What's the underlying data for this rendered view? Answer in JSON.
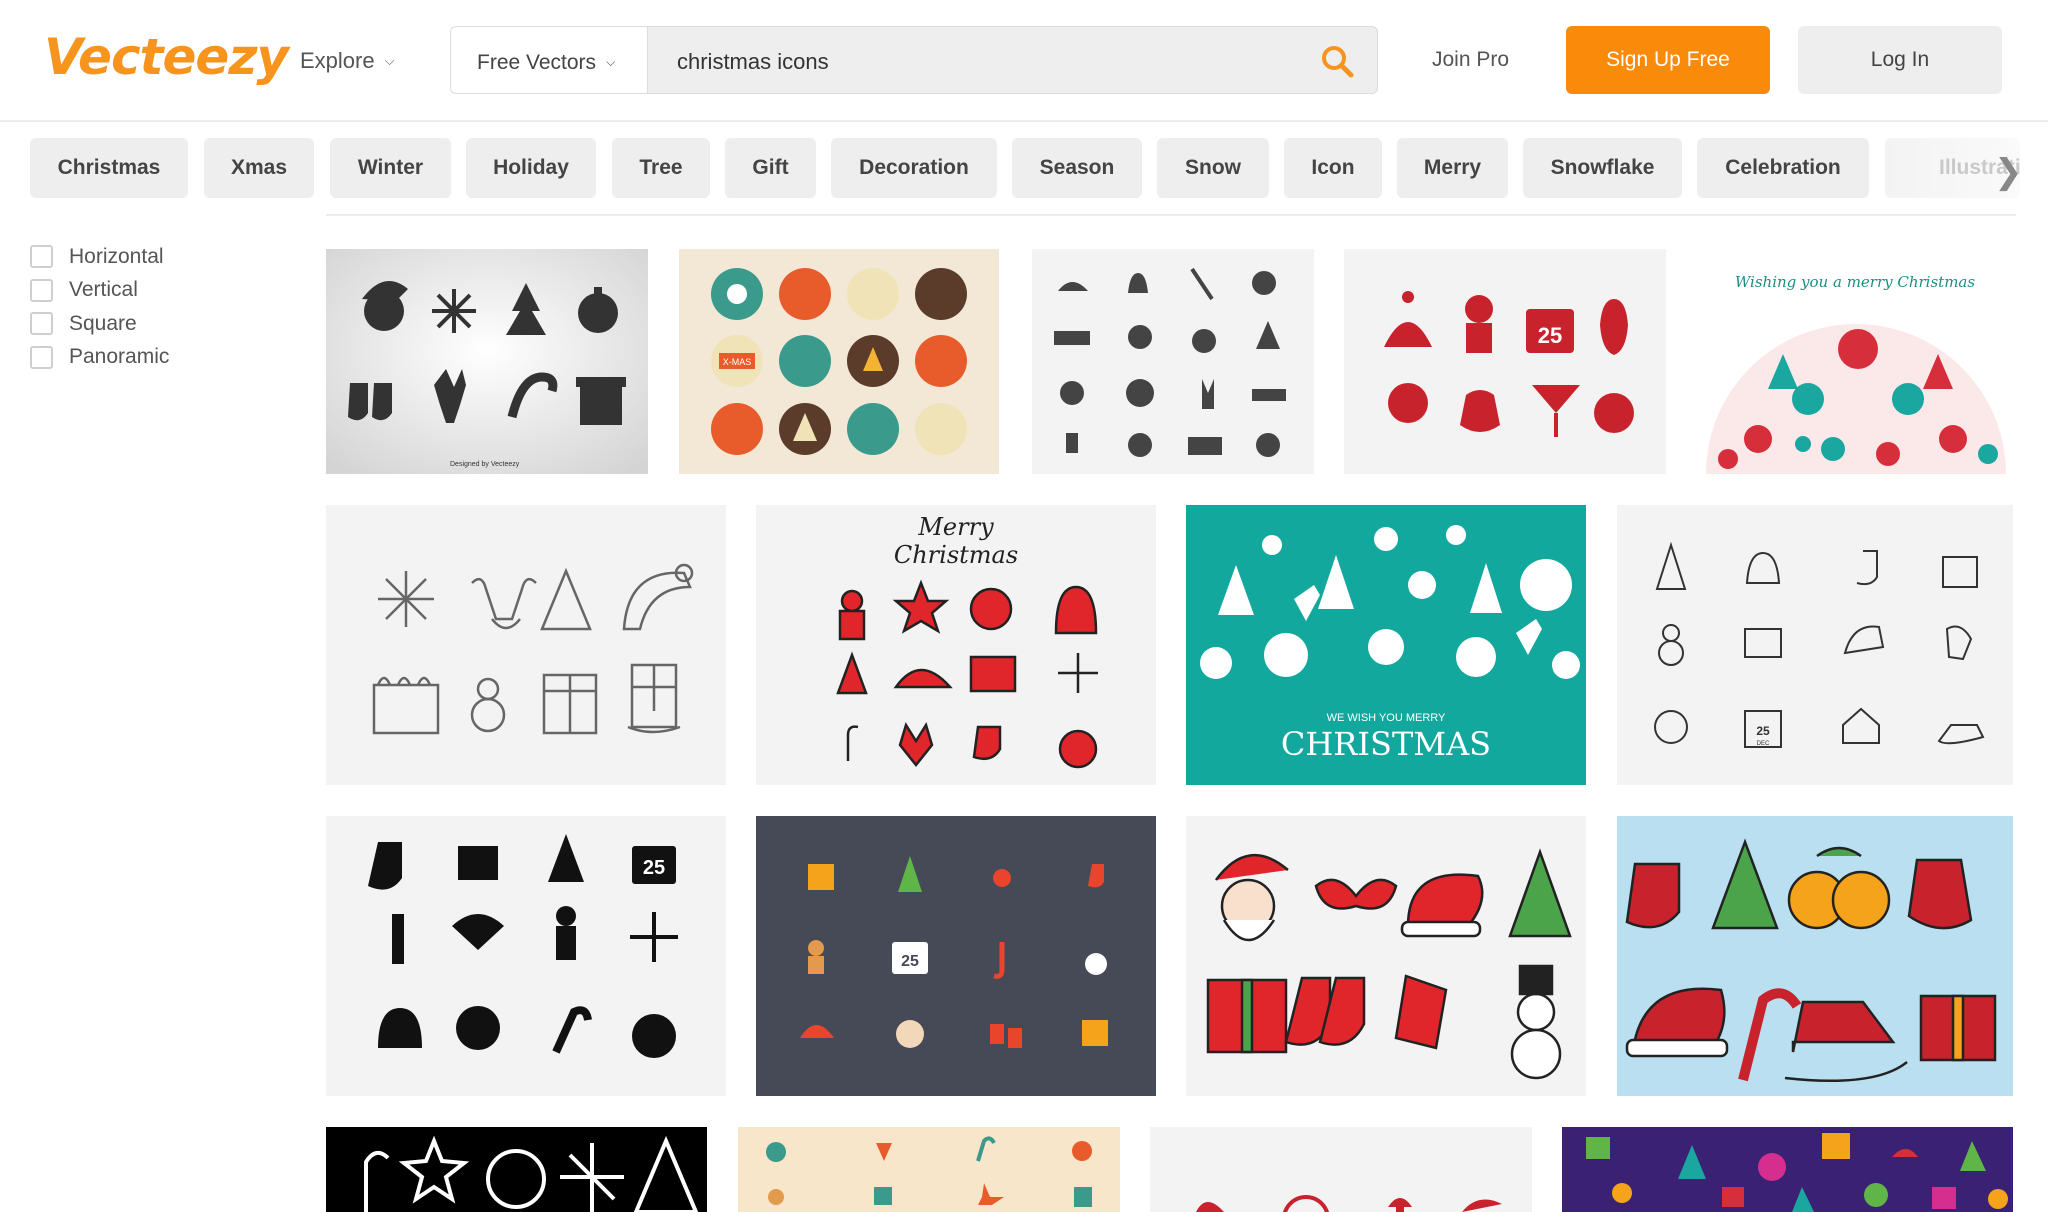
{
  "header": {
    "logo": "Vecteezy",
    "explore_label": "Explore",
    "search_type": "Free Vectors",
    "search_query": "christmas icons",
    "join_pro": "Join Pro",
    "sign_up": "Sign Up Free",
    "log_in": "Log In"
  },
  "tags": [
    "Christmas",
    "Xmas",
    "Winter",
    "Holiday",
    "Tree",
    "Gift",
    "Decoration",
    "Season",
    "Snow",
    "Icon",
    "Merry",
    "Snowflake",
    "Celebration",
    "Illustration"
  ],
  "filters": [
    "Horizontal",
    "Vertical",
    "Square",
    "Panoramic"
  ],
  "tile_text": {
    "credit": "Designed by Vecteezy",
    "badge": "X-MAS",
    "greeting_script": "Wishing you a merry Christmas",
    "merry": "Merry",
    "christmas_script": "Christmas",
    "wish": "WE WISH YOU MERRY",
    "christmas_caps": "CHRISTMAS",
    "cal_day": "25",
    "cal_month": "DEC"
  },
  "colors": {
    "brand": "#f7941d",
    "signup_bg": "#fa8a0a",
    "chip_bg": "#eeeeee",
    "teal_card": "#13a89e",
    "dark_card": "#464a57",
    "light_blue_card": "#b9dff0"
  }
}
